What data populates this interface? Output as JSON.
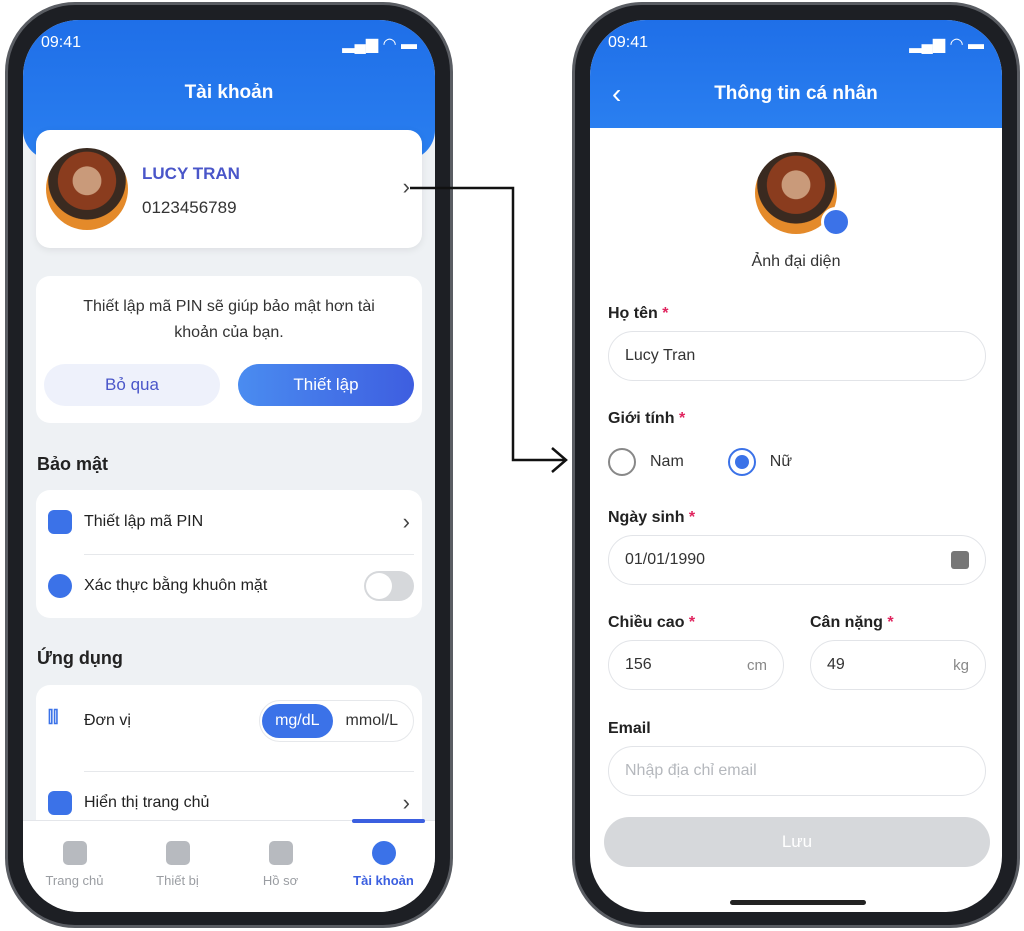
{
  "status_bar": {
    "time": "09:41"
  },
  "account_screen": {
    "title": "Tài khoản",
    "profile": {
      "name": "LUCY TRAN",
      "phone": "0123456789"
    },
    "pin_prompt": {
      "message": "Thiết lập mã PIN sẽ giúp bảo mật hơn tài khoản của bạn.",
      "skip_label": "Bỏ qua",
      "setup_label": "Thiết lập"
    },
    "security": {
      "heading": "Bảo mật",
      "items": [
        {
          "label": "Thiết lập mã PIN",
          "icon": "lock-icon"
        },
        {
          "label": "Xác thực bằng khuôn mặt",
          "icon": "face-id-icon",
          "toggle_on": false
        }
      ]
    },
    "app": {
      "heading": "Ứng dụng",
      "unit_label": "Đơn vị",
      "unit_options": [
        "mg/dL",
        "mmol/L"
      ],
      "unit_selected": "mg/dL",
      "home_display_label": "Hiển thị trang chủ"
    },
    "bottom_nav": [
      {
        "label": "Trang chủ",
        "icon": "home-icon"
      },
      {
        "label": "Thiết bị",
        "icon": "device-icon"
      },
      {
        "label": "Hồ sơ",
        "icon": "clipboard-icon"
      },
      {
        "label": "Tài khoản",
        "icon": "user-circle-icon",
        "active": true
      }
    ]
  },
  "profile_screen": {
    "title": "Thông tin cá nhân",
    "avatar_label": "Ảnh đại diện",
    "full_name": {
      "label": "Họ tên",
      "value": "Lucy Tran"
    },
    "gender": {
      "label": "Giới tính",
      "options": [
        "Nam",
        "Nữ"
      ],
      "selected": "Nữ"
    },
    "dob": {
      "label": "Ngày sinh",
      "value": "01/01/1990"
    },
    "height": {
      "label": "Chiều cao",
      "value": "156",
      "unit": "cm"
    },
    "weight": {
      "label": "Cân nặng",
      "value": "49",
      "unit": "kg"
    },
    "email": {
      "label": "Email",
      "placeholder": "Nhập địa chỉ email"
    },
    "save_label": "Lưu"
  },
  "required_mark": "*",
  "colors": {
    "primary": "#2a74ee",
    "accent_text": "#4a56c9",
    "required": "#e0245e"
  }
}
